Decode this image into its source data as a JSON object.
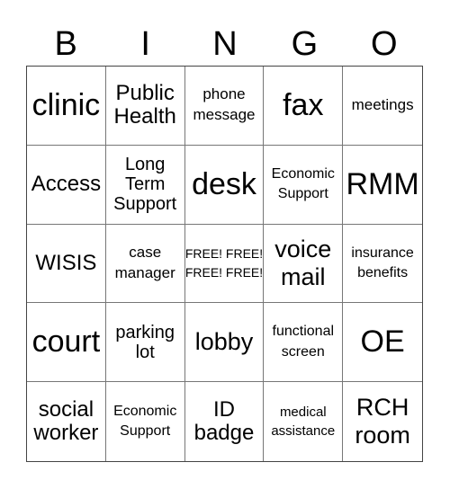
{
  "header": [
    "B",
    "I",
    "N",
    "G",
    "O"
  ],
  "cells": [
    {
      "text": "clinic",
      "size": "s38"
    },
    {
      "text": "Public Health",
      "size": "s24"
    },
    {
      "text": "phone message",
      "size": "s17"
    },
    {
      "text": "fax",
      "size": "s38"
    },
    {
      "text": "meetings",
      "size": "s17"
    },
    {
      "text": "Access",
      "size": "s24"
    },
    {
      "text": "Long Term Support",
      "size": "s20"
    },
    {
      "text": "desk",
      "size": "s38"
    },
    {
      "text": "Economic Support",
      "size": "s16"
    },
    {
      "text": "RMM",
      "size": "s38"
    },
    {
      "text": "WISIS",
      "size": "s24"
    },
    {
      "text": "case manager",
      "size": "s17"
    },
    {
      "text": "FREE! FREE! FREE! FREE!",
      "size": "s14"
    },
    {
      "text": "voice mail",
      "size": "s28"
    },
    {
      "text": "insurance benefits",
      "size": "s16"
    },
    {
      "text": "court",
      "size": "s38"
    },
    {
      "text": "parking lot",
      "size": "s20"
    },
    {
      "text": "lobby",
      "size": "s28"
    },
    {
      "text": "functional screen",
      "size": "s16"
    },
    {
      "text": "OE",
      "size": "s38"
    },
    {
      "text": "social worker",
      "size": "s24"
    },
    {
      "text": "Economic Support",
      "size": "s16"
    },
    {
      "text": "ID badge",
      "size": "s24"
    },
    {
      "text": "medical assistance",
      "size": "s15"
    },
    {
      "text": "RCH room",
      "size": "s28"
    }
  ]
}
